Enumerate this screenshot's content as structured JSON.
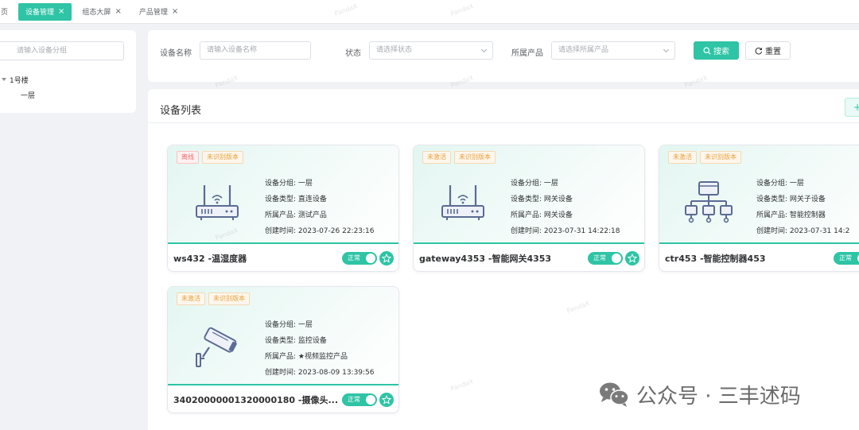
{
  "tabs": [
    {
      "label": "页",
      "closable": false,
      "active": false
    },
    {
      "label": "设备管理",
      "closable": true,
      "active": true
    },
    {
      "label": "组态大屏",
      "closable": true,
      "active": false
    },
    {
      "label": "产品管理",
      "closable": true,
      "active": false
    }
  ],
  "tree": {
    "search_placeholder": "请输入设备分组",
    "nodes": [
      {
        "label": "1号楼"
      },
      {
        "label": "一层"
      }
    ]
  },
  "filters": {
    "name_label": "设备名称",
    "name_placeholder": "请输入设备名称",
    "status_label": "状态",
    "status_placeholder": "请选择状态",
    "product_label": "所属产品",
    "product_placeholder": "请选择所属产品",
    "search_button": "搜索",
    "reset_button": "重置"
  },
  "list": {
    "title": "设备列表",
    "add_button": "+"
  },
  "info_labels": {
    "group": "设备分组:",
    "type": "设备类型:",
    "product": "所属产品:",
    "created": "创建时间:"
  },
  "devices": [
    {
      "badges": [
        "离线",
        "未识别版本"
      ],
      "icon": "router-icon",
      "group": "一层",
      "type": "直连设备",
      "product": "测试产品",
      "created": "2023-07-26 22:23:16",
      "name": "ws432 -温湿度器",
      "status": "正常"
    },
    {
      "badges": [
        "未激活",
        "未识别版本"
      ],
      "icon": "router-icon",
      "group": "一层",
      "type": "网关设备",
      "product": "网关设备",
      "created": "2023-07-31 14:22:18",
      "name": "gateway4353 -智能网关4353",
      "status": "正常"
    },
    {
      "badges": [
        "未激活",
        "未识别版本"
      ],
      "icon": "network-topology-icon",
      "group": "一层",
      "type": "网关子设备",
      "product": "智能控制器",
      "created": "2023-07-31 14:2",
      "name": "ctr453 -智能控制器453",
      "status": "正常"
    },
    {
      "badges": [
        "未激活",
        "未识别版本"
      ],
      "icon": "camera-icon",
      "group": "一层",
      "type": "监控设备",
      "product": "★视频监控产品",
      "created": "2023-08-09 13:39:56",
      "name": "34020000001320000180 -摄像头...",
      "status": "正常"
    }
  ],
  "footer_watermark": "公众号 · 三丰述码",
  "watermark_text": "PandaX",
  "colors": {
    "accent": "#2ec4a5",
    "offline": "#f56c6c",
    "warning": "#e6a23c",
    "icon": "#5b6b94"
  }
}
